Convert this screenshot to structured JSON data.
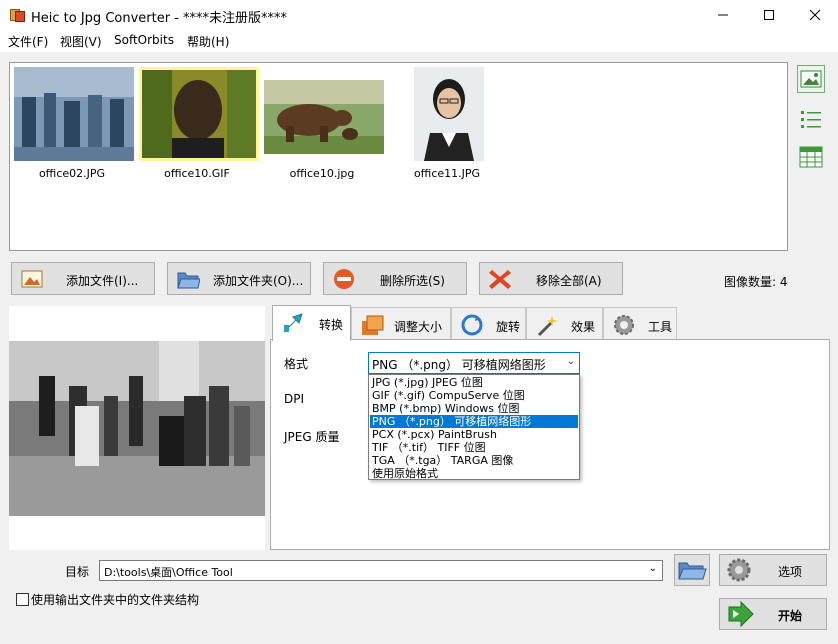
{
  "window": {
    "title": "Heic to Jpg Converter - ****未注册版****"
  },
  "menu": {
    "items": [
      "文件(F)",
      "视图(V)",
      "SoftOrbits",
      "帮助(H)"
    ]
  },
  "thumbnails": [
    {
      "caption": "office02.JPG"
    },
    {
      "caption": "office10.GIF"
    },
    {
      "caption": "office10.jpg"
    },
    {
      "caption": "office11.JPG"
    }
  ],
  "buttons": {
    "add_files": "添加文件(I)...",
    "add_folder": "添加文件夹(O)...",
    "remove_selected": "删除所选(S)",
    "remove_all": "移除全部(A)"
  },
  "image_count": "图像数量: 4",
  "tabs": [
    "转换",
    "调整大小",
    "旋转",
    "效果",
    "工具"
  ],
  "convert": {
    "format_label": "格式",
    "dpi_label": "DPI",
    "jpeg_quality_label": "JPEG 质量",
    "format_selected": "PNG （*.png） 可移植网络图形",
    "format_options": [
      "JPG (*.jpg) JPEG 位图",
      "GIF (*.gif) CompuServe 位图",
      "BMP (*.bmp) Windows 位图",
      "PNG （*.png） 可移植网络图形",
      "PCX (*.pcx) PaintBrush",
      "TIF （*.tif） TIFF 位图",
      "TGA （*.tga） TARGA 图像",
      "使用原始格式"
    ],
    "selected_index": 3
  },
  "target": {
    "label": "目标",
    "path": "D:\\tools\\桌面\\Office Tool"
  },
  "options_button": "选项",
  "start_button": "开始",
  "keep_structure_label": "使用输出文件夹中的文件夹结构",
  "colors": {
    "accent": "#0078d7",
    "start_arrow": "#3aa33a"
  }
}
